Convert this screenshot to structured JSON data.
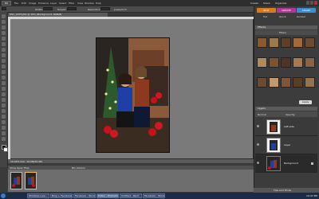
{
  "app": {
    "logo_label": "PS"
  },
  "menu": [
    "File",
    "Edit",
    "Image",
    "Enhance",
    "Layer",
    "Select",
    "Filter",
    "View",
    "Window",
    "Help"
  ],
  "titlebar": {
    "buttons": [
      "Create",
      "Share",
      "Organizer"
    ]
  },
  "options_bar": {
    "width_label": "Width:",
    "height_label": "Height:",
    "resolution_label": "Resolution:",
    "resolution_unit": "pixels/inch"
  },
  "document": {
    "tab_title": "DSC_0275.JPG @ 19% (Background, RGB/8)",
    "status": "19.03%   Doc: 10.2M/10.2M"
  },
  "project_bin": {
    "tabs": [
      "Show Open Files",
      "Bin Actions"
    ]
  },
  "right_panel": {
    "tabs": [
      "EDIT",
      "CREATE",
      "SHARE"
    ],
    "tab_colors": [
      "#d97a1e",
      "#b2369a",
      "#3a8fd0"
    ],
    "mode_buttons": [
      "Full",
      "Quick",
      "Guided"
    ],
    "effects_header": "Effects",
    "effects_filter": "Filters",
    "apply_label": "Apply",
    "layers_header": "Layers",
    "blend_mode": "Normal",
    "opacity_label": "Opacity:",
    "layers": [
      {
        "name": "Left side",
        "selected": false
      },
      {
        "name": "Layer",
        "selected": false
      },
      {
        "name": "Background",
        "selected": true
      }
    ],
    "bin_actions": "Tips and Tricks"
  },
  "taskbar": {
    "tasks": [
      {
        "label": "Windows Live..."
      },
      {
        "label": "Bing + Facebook..."
      },
      {
        "label": "Facebook - Windows..."
      },
      {
        "label": "Editor - Photoshop..."
      },
      {
        "label": "Untitled - Paint"
      },
      {
        "label": "Facebook - Windows..."
      }
    ],
    "active_index": 3,
    "clock": "10:47 PM"
  },
  "accent_color": "#d97a1e"
}
